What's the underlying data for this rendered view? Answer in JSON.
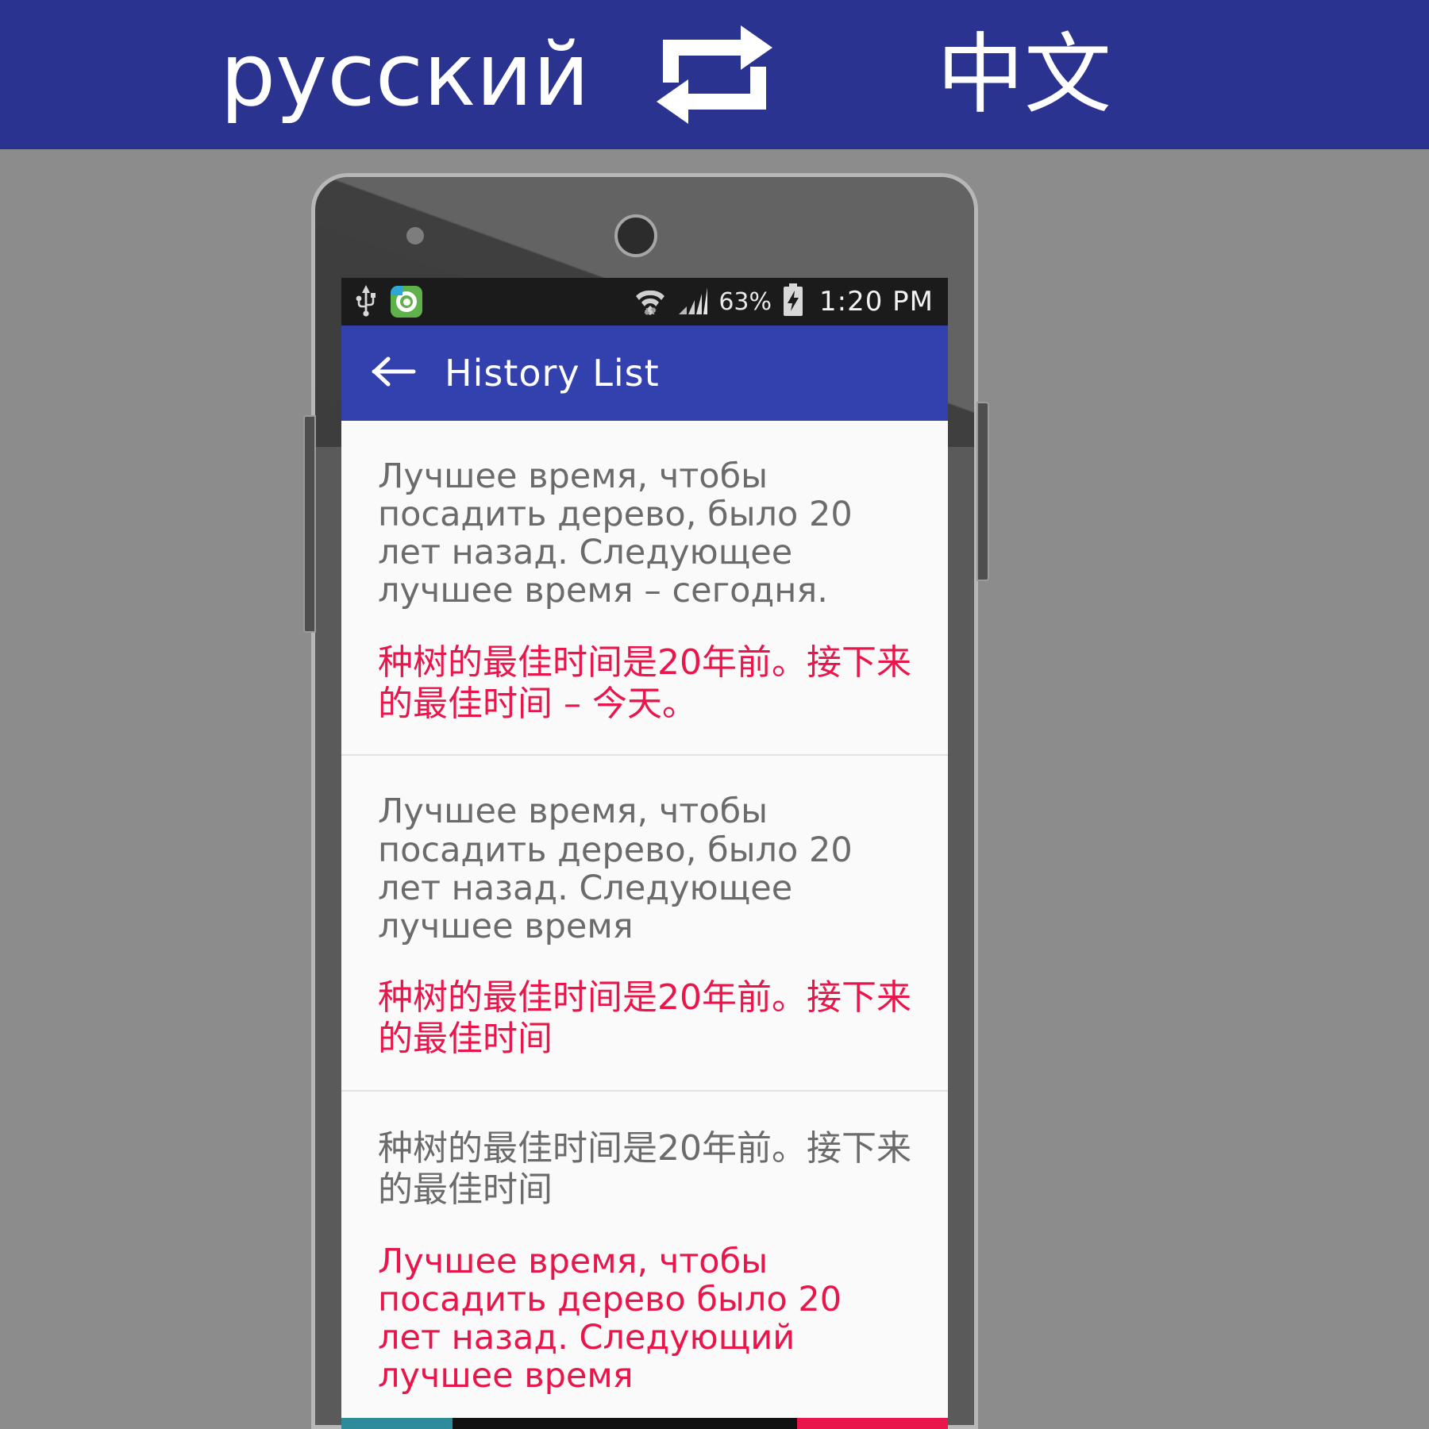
{
  "promo": {
    "source_language": "русский",
    "target_language": "中文",
    "swap_icon": "swap-arrows-icon",
    "background_color": "#2a3490",
    "text_color": "#ffffff"
  },
  "phone": {
    "status_bar": {
      "usb_icon": "usb-icon",
      "app_notification_icon": "app-badge-icon",
      "wifi_icon": "wifi-icon",
      "signal_icon": "signal-bars-icon",
      "battery_percent": "63%",
      "battery_icon": "battery-charging-icon",
      "clock": "1:20 PM"
    },
    "app_bar": {
      "back_icon": "back-arrow-icon",
      "title": "History List",
      "background_color": "#3341ae"
    },
    "colors": {
      "source_text": "#6b6b6b",
      "target_text": "#e8164b",
      "list_background": "#fafafa"
    },
    "history": [
      {
        "source": "Лучшее время, чтобы посадить дерево, было 20 лет назад. Следующее лучшее время – сегодня.",
        "target": "种树的最佳时间是20年前。接下来的最佳时间 – 今天。",
        "source_script": "cyrillic",
        "target_script": "cjk"
      },
      {
        "source": "Лучшее время, чтобы посадить дерево, было 20 лет назад. Следующее лучшее время",
        "target": "种树的最佳时间是20年前。接下来的最佳时间",
        "source_script": "cyrillic",
        "target_script": "cjk"
      },
      {
        "source": "种树的最佳时间是20年前。接下来的最佳时间",
        "target": "Лучшее время, чтобы посадить дерево было 20 лет назад. Следующий лучшее время",
        "source_script": "cjk",
        "target_script": "cyrillic"
      }
    ]
  }
}
